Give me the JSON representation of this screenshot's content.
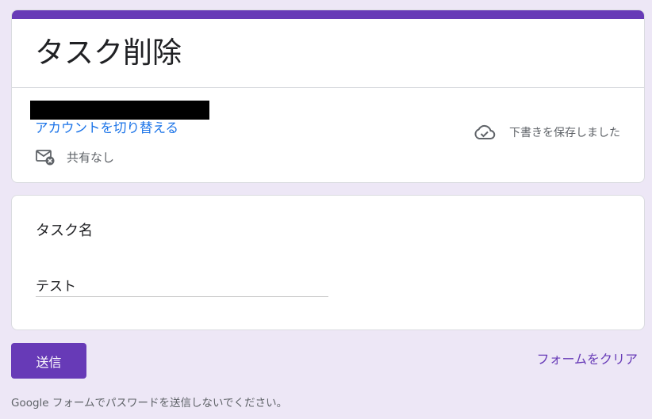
{
  "form": {
    "title": "タスク削除",
    "theme_color": "#673ab7",
    "background_color": "#ede7f6"
  },
  "account": {
    "email": "",
    "switch_account_label": "アカウントを切り替える",
    "switch_account_color": "#1a73e8",
    "sharing_status": "共有なし",
    "sharing_icon": "mail-not-shared-icon",
    "draft_status": "下書きを保存しました",
    "draft_icon": "cloud-check-icon"
  },
  "question": {
    "label": "タスク名",
    "answer_value": "テスト"
  },
  "actions": {
    "submit_label": "送信",
    "clear_label": "フォームをクリア"
  },
  "footer": {
    "note": "Google フォームでパスワードを送信しないでください。"
  }
}
